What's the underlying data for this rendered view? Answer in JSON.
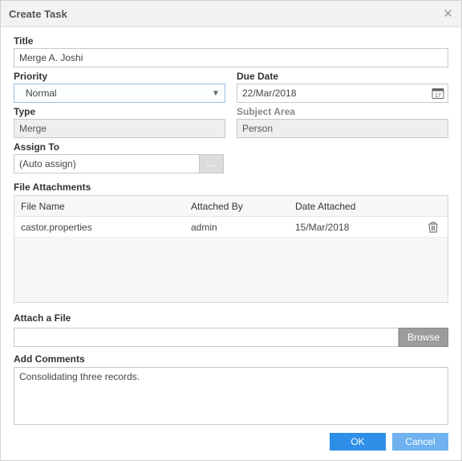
{
  "dialog": {
    "title": "Create Task"
  },
  "fields": {
    "title_label": "Title",
    "title_value": "Merge A. Joshi",
    "priority_label": "Priority",
    "priority_value": "Normal",
    "due_date_label": "Due Date",
    "due_date_value": "22/Mar/2018",
    "cal_day": "17",
    "type_label": "Type",
    "type_value": "Merge",
    "subject_area_label": "Subject Area",
    "subject_area_value": "Person",
    "assign_to_label": "Assign To",
    "assign_to_value": "(Auto assign)",
    "assign_btn": "...",
    "file_attachments_label": "File Attachments",
    "attach_file_label": "Attach a File",
    "browse_label": "Browse",
    "add_comments_label": "Add Comments",
    "comments_value": "Consolidating three records."
  },
  "file_table": {
    "headers": {
      "name": "File Name",
      "by": "Attached By",
      "date": "Date Attached"
    },
    "rows": [
      {
        "name": "castor.properties",
        "by": "admin",
        "date": "15/Mar/2018"
      }
    ]
  },
  "footer": {
    "ok": "OK",
    "cancel": "Cancel"
  }
}
